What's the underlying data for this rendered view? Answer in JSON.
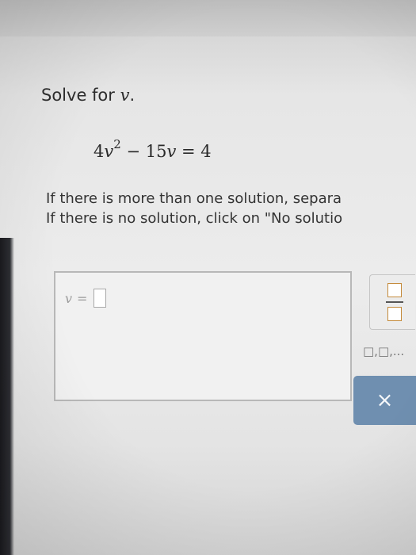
{
  "question": {
    "prompt_prefix": "Solve for ",
    "prompt_variable": "v",
    "prompt_suffix": ".",
    "equation": {
      "coefficient": "4",
      "variable": "v",
      "exponent": "2",
      "middle": " − 15",
      "variable2": "v",
      "rhs": " = 4"
    },
    "instruction_line1": "If there is more than one solution, separa",
    "instruction_line2": "If there is no solution, click on \"No solutio"
  },
  "answer": {
    "variable": "v",
    "equals": "=",
    "value": ""
  },
  "tools": {
    "fraction_icon": "fraction-template-icon",
    "list_label": "□,□,...",
    "clear_symbol": "×"
  }
}
